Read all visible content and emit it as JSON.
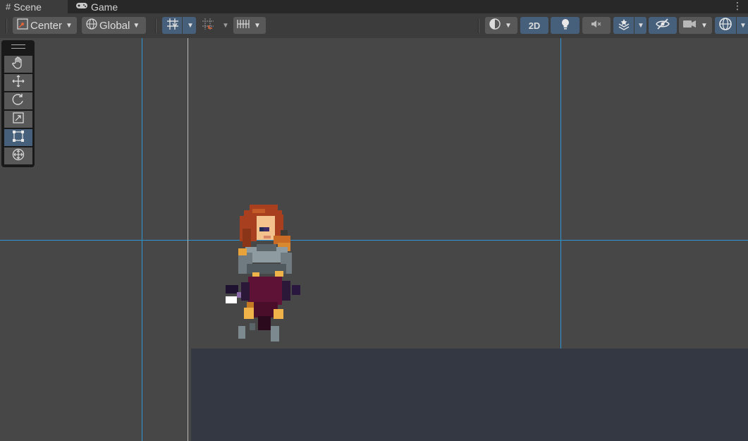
{
  "tabs": [
    {
      "label": "Scene",
      "icon": "hash-icon",
      "active": true
    },
    {
      "label": "Game",
      "icon": "gamepad-icon",
      "active": false
    }
  ],
  "toolbar": {
    "pivot_mode": "Center",
    "pivot_rotation": "Global",
    "mode_2d": "2D"
  },
  "tools": [
    "hand-tool",
    "move-tool",
    "rotate-tool",
    "scale-tool",
    "rect-tool",
    "transform-tool"
  ],
  "colors": {
    "accent": "#46607c",
    "grid_line": "#2e95d2",
    "scene_bg": "#474747",
    "floor": "#343842"
  }
}
